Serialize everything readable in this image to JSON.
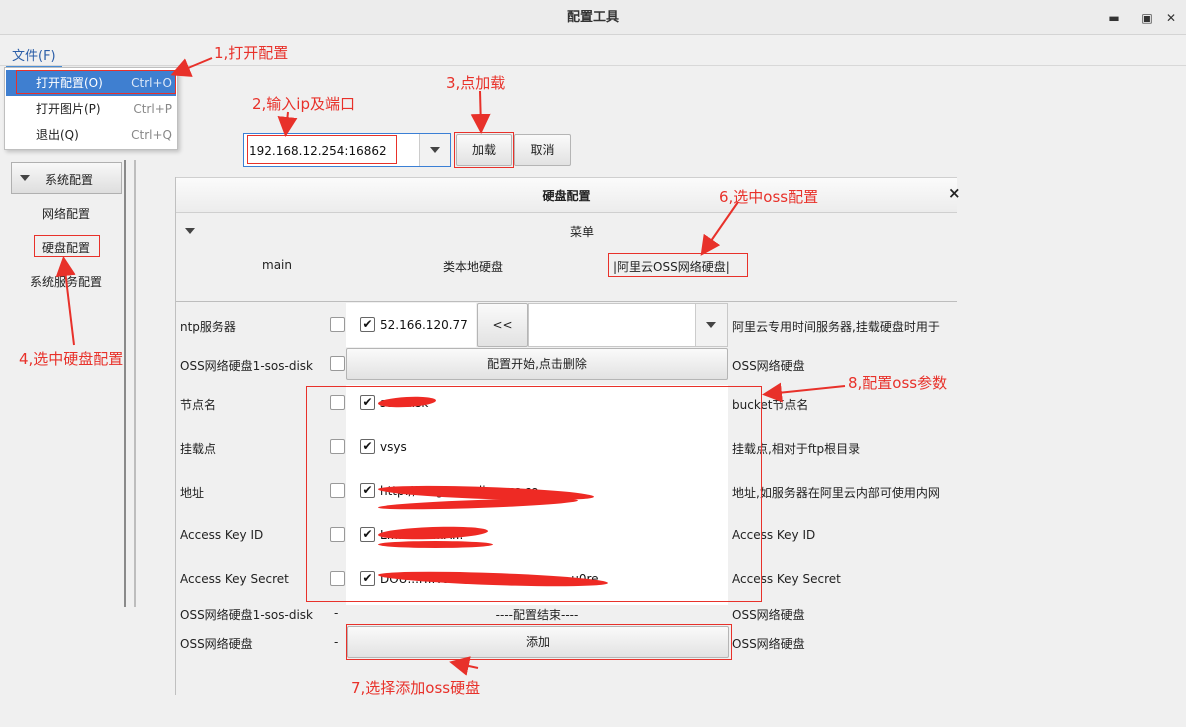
{
  "window": {
    "title": "配置工具",
    "minimize_glyph": "▬",
    "maximize_glyph": "▣",
    "close_glyph": "✕"
  },
  "menu": {
    "file_label": "文件(F)",
    "items": [
      {
        "label": "打开配置(O)",
        "shortcut": "Ctrl+O"
      },
      {
        "label": "打开图片(P)",
        "shortcut": "Ctrl+P"
      },
      {
        "label": "退出(Q)",
        "shortcut": "Ctrl+Q"
      }
    ]
  },
  "connection": {
    "address_value": "192.168.12.254:16862",
    "load_label": "加载",
    "cancel_label": "取消"
  },
  "sidebar": {
    "system_config": "系统配置",
    "items": [
      "网络配置",
      "硬盘配置",
      "系统服务配置"
    ]
  },
  "disk_panel": {
    "title": "硬盘配置",
    "close_glyph": "×",
    "menu_label": "菜单",
    "tabs": [
      "main",
      "类本地硬盘",
      "|阿里云OSS网络硬盘|"
    ]
  },
  "rows": {
    "ntp": {
      "label": "ntp服务器",
      "value": "52.166.120.77",
      "prev_button": "<<",
      "desc": "阿里云专用时间服务器,挂载硬盘时用于"
    },
    "oss_disk": {
      "label": "OSS网络硬盘1-sos-disk",
      "button": "配置开始,点击删除",
      "desc": "OSS网络硬盘"
    },
    "node": {
      "label": "节点名",
      "value": "sos-disk",
      "desc": "bucket节点名"
    },
    "mount": {
      "label": "挂载点",
      "value": "vsys",
      "desc": "挂载点,相对于ftp根目录"
    },
    "address": {
      "label": "地址",
      "value": "http://...ng...cs.aliyuncs.co",
      "desc": "地址,如服务器在阿里云内部可使用内网"
    },
    "key_id": {
      "label": "Access Key ID",
      "value": "L...............A...",
      "desc": "Access Key ID"
    },
    "key_secret": {
      "label": "Access Key Secret",
      "value": "DOU...F...Y9M8...........................u0re",
      "desc": "Access Key Secret"
    },
    "end": {
      "label": "OSS网络硬盘1-sos-disk",
      "dash": "-",
      "value": "----配置结束----",
      "desc": "OSS网络硬盘"
    },
    "add": {
      "label": "OSS网络硬盘",
      "dash": "-",
      "button": "添加",
      "desc": "OSS网络硬盘"
    }
  },
  "annotations": {
    "a1": "1,打开配置",
    "a2": "2,输入ip及端口",
    "a3": "3,点加载",
    "a4": "4,选中硬盘配置",
    "a6": "6,选中oss配置",
    "a7": "7,选择添加oss硬盘",
    "a8": "8,配置oss参数"
  },
  "colors": {
    "annotation_red": "#e8312a",
    "selection_blue": "#3f7fd0",
    "focus_blue": "#3a7fd5"
  },
  "check_glyph": "✔"
}
